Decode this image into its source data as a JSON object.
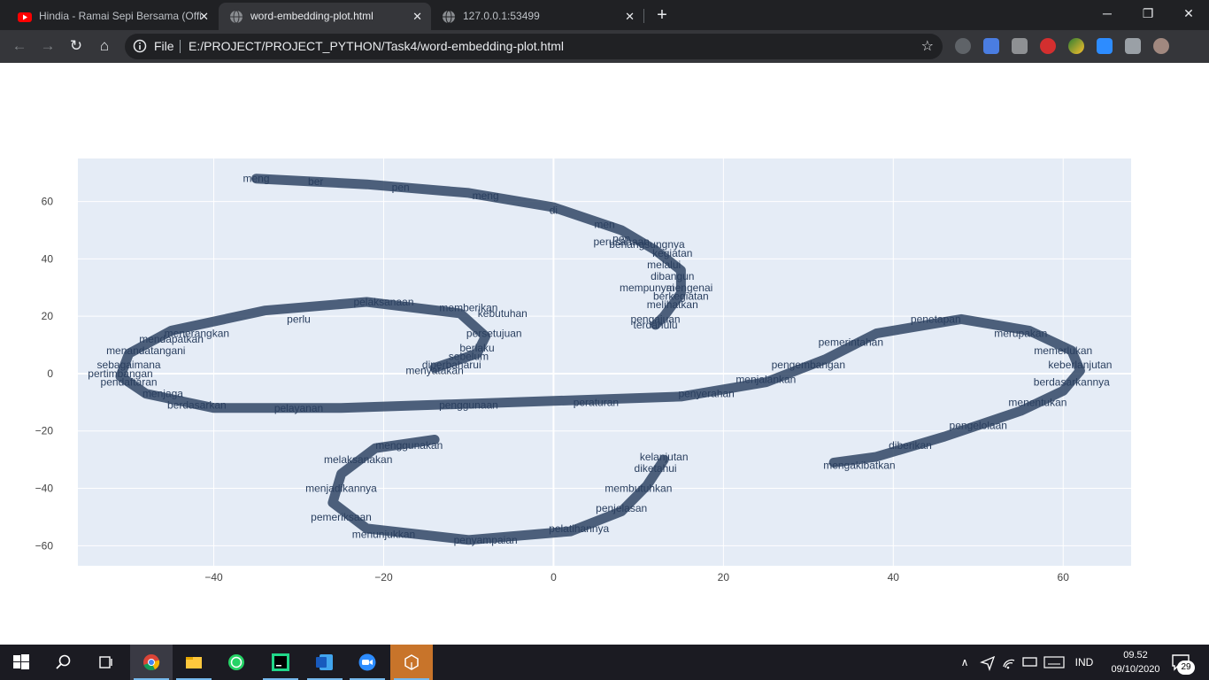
{
  "browser": {
    "tabs": [
      {
        "title": "Hindia - Ramai Sepi Bersama (Offi",
        "icon": "youtube-icon",
        "active": false
      },
      {
        "title": "word-embedding-plot.html",
        "icon": "globe-icon",
        "active": true
      },
      {
        "title": "127.0.0.1:53499",
        "icon": "globe-icon",
        "active": false
      }
    ],
    "tab_close": "✕",
    "new_tab": "+",
    "window_controls": {
      "minimize": "─",
      "maximize": "❐",
      "close": "✕"
    },
    "nav": {
      "back": "←",
      "forward": "→",
      "reload": "↻",
      "home": "⌂"
    },
    "address": {
      "scheme_label": "File",
      "url": "E:/PROJECT/PROJECT_PYTHON/Task4/word-embedding-plot.html",
      "star": "☆"
    },
    "extensions": [
      "screenshot-icon",
      "translate-icon",
      "extension-icon",
      "adblock-icon",
      "earth-icon",
      "zoom-icon",
      "puzzle-icon",
      "profile-avatar"
    ]
  },
  "chart_data": {
    "type": "scatter",
    "title": "",
    "xlabel": "",
    "ylabel": "",
    "xlim": [
      -56,
      68
    ],
    "ylim": [
      -67,
      75
    ],
    "x_ticks": [
      -40,
      -20,
      0,
      20,
      40,
      60
    ],
    "y_ticks": [
      -60,
      -40,
      -20,
      0,
      20,
      40,
      60
    ],
    "x_tick_labels": [
      "−40",
      "−20",
      "0",
      "20",
      "40",
      "60"
    ],
    "y_tick_labels": [
      "−60",
      "−40",
      "−20",
      "0",
      "20",
      "40",
      "60"
    ],
    "grid": true,
    "legend": "none",
    "colors": {
      "plot_bg": "#e5ecf6",
      "grid": "#ffffff",
      "text": "#2a3f5f"
    },
    "series": [
      {
        "marker": "text",
        "points": [
          {
            "x": -35,
            "y": 68,
            "label": "meng"
          },
          {
            "x": -28,
            "y": 67,
            "label": "ber"
          },
          {
            "x": -18,
            "y": 65,
            "label": "pen"
          },
          {
            "x": -8,
            "y": 62,
            "label": "meng"
          },
          {
            "x": 0,
            "y": 57,
            "label": "di"
          },
          {
            "x": 6,
            "y": 52,
            "label": "men"
          },
          {
            "x": 8,
            "y": 47,
            "label": "pen"
          },
          {
            "x": 11,
            "y": 45,
            "label": "berlangsungnya"
          },
          {
            "x": 8,
            "y": 46,
            "label": "perusahaan"
          },
          {
            "x": 14,
            "y": 42,
            "label": "kegiatan"
          },
          {
            "x": 13,
            "y": 38,
            "label": "melalui"
          },
          {
            "x": 14,
            "y": 34,
            "label": "dibangun"
          },
          {
            "x": 11,
            "y": 30,
            "label": "mempunyai"
          },
          {
            "x": 16,
            "y": 30,
            "label": "mengenai"
          },
          {
            "x": 15,
            "y": 27,
            "label": "berkegiatan"
          },
          {
            "x": 14,
            "y": 24,
            "label": "melihatkan"
          },
          {
            "x": 12,
            "y": 17,
            "label": "terdahulu"
          },
          {
            "x": 12,
            "y": 19,
            "label": "pengajuan"
          },
          {
            "x": -20,
            "y": 25,
            "label": "pelaksanaan"
          },
          {
            "x": -10,
            "y": 23,
            "label": "memberikan"
          },
          {
            "x": -6,
            "y": 21,
            "label": "kebutuhan"
          },
          {
            "x": -7,
            "y": 14,
            "label": "persetujuan"
          },
          {
            "x": -9,
            "y": 9,
            "label": "berlaku"
          },
          {
            "x": -10,
            "y": 6,
            "label": "sebelum"
          },
          {
            "x": -12,
            "y": 3,
            "label": "diperbaharui"
          },
          {
            "x": -14,
            "y": 1,
            "label": "menyatakan"
          },
          {
            "x": -30,
            "y": 19,
            "label": "perlu"
          },
          {
            "x": -42,
            "y": 14,
            "label": "menerangkan"
          },
          {
            "x": -45,
            "y": 12,
            "label": "mendapatkan"
          },
          {
            "x": -48,
            "y": 8,
            "label": "menandatangani"
          },
          {
            "x": -50,
            "y": 3,
            "label": "sebagaimana"
          },
          {
            "x": -51,
            "y": 0,
            "label": "pertimbangan"
          },
          {
            "x": -50,
            "y": -3,
            "label": "pendaftaran"
          },
          {
            "x": -46,
            "y": -7,
            "label": "menjaga"
          },
          {
            "x": -42,
            "y": -11,
            "label": "berdasarkan"
          },
          {
            "x": -30,
            "y": -12,
            "label": "pelayanan"
          },
          {
            "x": -10,
            "y": -11,
            "label": "penggunaan"
          },
          {
            "x": 5,
            "y": -10,
            "label": "peraturan"
          },
          {
            "x": 18,
            "y": -7,
            "label": "penyerahan"
          },
          {
            "x": 25,
            "y": -2,
            "label": "menjalankan"
          },
          {
            "x": 30,
            "y": 3,
            "label": "pengembangan"
          },
          {
            "x": 35,
            "y": 11,
            "label": "pemerintahan"
          },
          {
            "x": 45,
            "y": 19,
            "label": "penetapan"
          },
          {
            "x": 55,
            "y": 14,
            "label": "merupakan"
          },
          {
            "x": 60,
            "y": 8,
            "label": "memerlukan"
          },
          {
            "x": 62,
            "y": 3,
            "label": "keberlanjutan"
          },
          {
            "x": 61,
            "y": -3,
            "label": "berdasarkannya"
          },
          {
            "x": 57,
            "y": -10,
            "label": "menentukan"
          },
          {
            "x": 50,
            "y": -18,
            "label": "pengelolaan"
          },
          {
            "x": 42,
            "y": -25,
            "label": "diberikan"
          },
          {
            "x": 36,
            "y": -32,
            "label": "mengakibatkan"
          },
          {
            "x": -17,
            "y": -25,
            "label": "menggunakan"
          },
          {
            "x": -23,
            "y": -30,
            "label": "melaksanakan"
          },
          {
            "x": -25,
            "y": -40,
            "label": "menjadikannya"
          },
          {
            "x": -25,
            "y": -50,
            "label": "pemeriksaan"
          },
          {
            "x": -20,
            "y": -56,
            "label": "menunjukkan"
          },
          {
            "x": -8,
            "y": -58,
            "label": "penyampaian"
          },
          {
            "x": 3,
            "y": -54,
            "label": "pelatihannya"
          },
          {
            "x": 8,
            "y": -47,
            "label": "penjelasan"
          },
          {
            "x": 10,
            "y": -40,
            "label": "membutuhkan"
          },
          {
            "x": 12,
            "y": -33,
            "label": "diketahui"
          },
          {
            "x": 13,
            "y": -29,
            "label": "kelanjutan"
          }
        ]
      }
    ]
  },
  "taskbar": {
    "apps": [
      "windows-start-icon",
      "search-icon",
      "task-view-icon",
      "chrome-icon",
      "file-explorer-icon",
      "whatsapp-icon",
      "pycharm-icon",
      "word-icon",
      "zoom-icon",
      "unity-icon"
    ],
    "tray": {
      "chevron": "∧",
      "language": "IND"
    },
    "clock": {
      "time": "09.52",
      "date": "09/10/2020"
    },
    "notifications": "29"
  }
}
